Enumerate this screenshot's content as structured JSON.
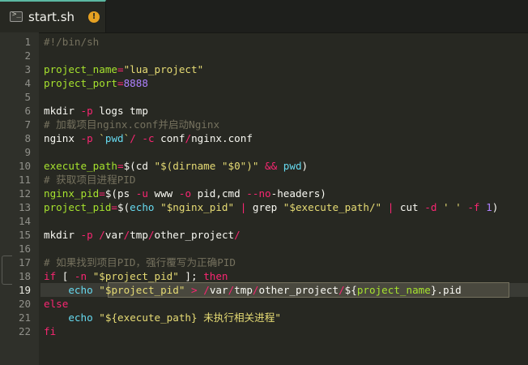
{
  "tab": {
    "title": "start.sh",
    "badge": "!"
  },
  "editor": {
    "current_line": 19,
    "lines": [
      {
        "n": "1",
        "t": [
          {
            "c": "c-cm",
            "s": "#!/bin/sh"
          }
        ]
      },
      {
        "n": "2",
        "t": []
      },
      {
        "n": "3",
        "t": [
          {
            "c": "c-var",
            "s": "project_name"
          },
          {
            "c": "c-kw",
            "s": "="
          },
          {
            "c": "c-str",
            "s": "\"lua_project\""
          }
        ]
      },
      {
        "n": "4",
        "t": [
          {
            "c": "c-var",
            "s": "project_port"
          },
          {
            "c": "c-kw",
            "s": "="
          },
          {
            "c": "c-num",
            "s": "8888"
          }
        ]
      },
      {
        "n": "5",
        "t": []
      },
      {
        "n": "6",
        "t": [
          {
            "c": "c-def",
            "s": "mkdir "
          },
          {
            "c": "c-kw",
            "s": "-p"
          },
          {
            "c": "c-def",
            "s": " logs tmp"
          }
        ]
      },
      {
        "n": "7",
        "t": [
          {
            "c": "c-cm",
            "s": "# 加载项目nginx.conf并启动Nginx"
          }
        ]
      },
      {
        "n": "8",
        "t": [
          {
            "c": "c-def",
            "s": "nginx "
          },
          {
            "c": "c-kw",
            "s": "-p"
          },
          {
            "c": "c-def",
            "s": " "
          },
          {
            "c": "c-str",
            "s": "`"
          },
          {
            "c": "c-fn",
            "s": "pwd"
          },
          {
            "c": "c-str",
            "s": "`"
          },
          {
            "c": "c-kw",
            "s": "/"
          },
          {
            "c": "c-def",
            "s": " "
          },
          {
            "c": "c-kw",
            "s": "-c"
          },
          {
            "c": "c-def",
            "s": " conf"
          },
          {
            "c": "c-kw",
            "s": "/"
          },
          {
            "c": "c-def",
            "s": "nginx.conf"
          }
        ]
      },
      {
        "n": "9",
        "t": []
      },
      {
        "n": "10",
        "t": [
          {
            "c": "c-var",
            "s": "execute_path"
          },
          {
            "c": "c-kw",
            "s": "="
          },
          {
            "c": "c-def",
            "s": "$(cd "
          },
          {
            "c": "c-str",
            "s": "\"$(dirname \"$0\")\""
          },
          {
            "c": "c-def",
            "s": " "
          },
          {
            "c": "c-kw",
            "s": "&&"
          },
          {
            "c": "c-def",
            "s": " "
          },
          {
            "c": "c-fn",
            "s": "pwd"
          },
          {
            "c": "c-def",
            "s": ")"
          }
        ]
      },
      {
        "n": "11",
        "t": [
          {
            "c": "c-cm",
            "s": "# 获取项目进程PID"
          }
        ]
      },
      {
        "n": "12",
        "t": [
          {
            "c": "c-var",
            "s": "nginx_pid"
          },
          {
            "c": "c-kw",
            "s": "="
          },
          {
            "c": "c-def",
            "s": "$(ps "
          },
          {
            "c": "c-kw",
            "s": "-u"
          },
          {
            "c": "c-def",
            "s": " www "
          },
          {
            "c": "c-kw",
            "s": "-o"
          },
          {
            "c": "c-def",
            "s": " pid,cmd "
          },
          {
            "c": "c-kw",
            "s": "--no"
          },
          {
            "c": "c-def",
            "s": "-headers)"
          }
        ]
      },
      {
        "n": "13",
        "t": [
          {
            "c": "c-var",
            "s": "project_pid"
          },
          {
            "c": "c-kw",
            "s": "="
          },
          {
            "c": "c-def",
            "s": "$("
          },
          {
            "c": "c-fn",
            "s": "echo"
          },
          {
            "c": "c-def",
            "s": " "
          },
          {
            "c": "c-str",
            "s": "\"$nginx_pid\""
          },
          {
            "c": "c-def",
            "s": " "
          },
          {
            "c": "c-kw",
            "s": "|"
          },
          {
            "c": "c-def",
            "s": " grep "
          },
          {
            "c": "c-str",
            "s": "\"$execute_path/\""
          },
          {
            "c": "c-def",
            "s": " "
          },
          {
            "c": "c-kw",
            "s": "|"
          },
          {
            "c": "c-def",
            "s": " cut "
          },
          {
            "c": "c-kw",
            "s": "-d"
          },
          {
            "c": "c-def",
            "s": " "
          },
          {
            "c": "c-str",
            "s": "' '"
          },
          {
            "c": "c-def",
            "s": " "
          },
          {
            "c": "c-kw",
            "s": "-f"
          },
          {
            "c": "c-def",
            "s": " "
          },
          {
            "c": "c-num",
            "s": "1"
          },
          {
            "c": "c-def",
            "s": ")"
          }
        ]
      },
      {
        "n": "14",
        "t": []
      },
      {
        "n": "15",
        "t": [
          {
            "c": "c-def",
            "s": "mkdir "
          },
          {
            "c": "c-kw",
            "s": "-p"
          },
          {
            "c": "c-def",
            "s": " "
          },
          {
            "c": "c-kw",
            "s": "/"
          },
          {
            "c": "c-def",
            "s": "var"
          },
          {
            "c": "c-kw",
            "s": "/"
          },
          {
            "c": "c-def",
            "s": "tmp"
          },
          {
            "c": "c-kw",
            "s": "/"
          },
          {
            "c": "c-def",
            "s": "other_project"
          },
          {
            "c": "c-kw",
            "s": "/"
          }
        ]
      },
      {
        "n": "16",
        "t": []
      },
      {
        "n": "17",
        "t": [
          {
            "c": "c-cm",
            "s": "# 如果找到项目PID，强行覆写为正确PID"
          }
        ]
      },
      {
        "n": "18",
        "t": [
          {
            "c": "c-kw",
            "s": "if"
          },
          {
            "c": "c-def",
            "s": " [ "
          },
          {
            "c": "c-kw",
            "s": "-n"
          },
          {
            "c": "c-def",
            "s": " "
          },
          {
            "c": "c-str",
            "s": "\"$project_pid\""
          },
          {
            "c": "c-def",
            "s": " ]; "
          },
          {
            "c": "c-kw",
            "s": "then"
          }
        ]
      },
      {
        "n": "19",
        "t": [
          {
            "c": "c-def",
            "s": "    "
          },
          {
            "c": "c-fn",
            "s": "echo"
          },
          {
            "c": "c-def",
            "s": " "
          },
          {
            "c": "c-str",
            "s": "\"$project_pid\""
          },
          {
            "c": "c-def",
            "s": " "
          },
          {
            "c": "c-kw",
            "s": ">"
          },
          {
            "c": "c-def",
            "s": " "
          },
          {
            "c": "c-kw",
            "s": "/"
          },
          {
            "c": "c-def",
            "s": "var"
          },
          {
            "c": "c-kw",
            "s": "/"
          },
          {
            "c": "c-def",
            "s": "tmp"
          },
          {
            "c": "c-kw",
            "s": "/"
          },
          {
            "c": "c-def",
            "s": "other_project"
          },
          {
            "c": "c-kw",
            "s": "/"
          },
          {
            "c": "c-def",
            "s": "${"
          },
          {
            "c": "c-var",
            "s": "project_name"
          },
          {
            "c": "c-def",
            "s": "}.pid"
          }
        ]
      },
      {
        "n": "20",
        "t": [
          {
            "c": "c-kw",
            "s": "else"
          }
        ]
      },
      {
        "n": "21",
        "t": [
          {
            "c": "c-def",
            "s": "    "
          },
          {
            "c": "c-fn",
            "s": "echo"
          },
          {
            "c": "c-def",
            "s": " "
          },
          {
            "c": "c-str",
            "s": "\"${execute_path} 未执行相关进程\""
          }
        ]
      },
      {
        "n": "22",
        "t": [
          {
            "c": "c-kw",
            "s": "fi"
          }
        ]
      }
    ]
  },
  "colors": {
    "background": "#272822",
    "accent": "#5bb8a2",
    "badge": "#e6a122"
  },
  "icons": {
    "tab": "terminal-icon",
    "badge": "warning-icon"
  }
}
